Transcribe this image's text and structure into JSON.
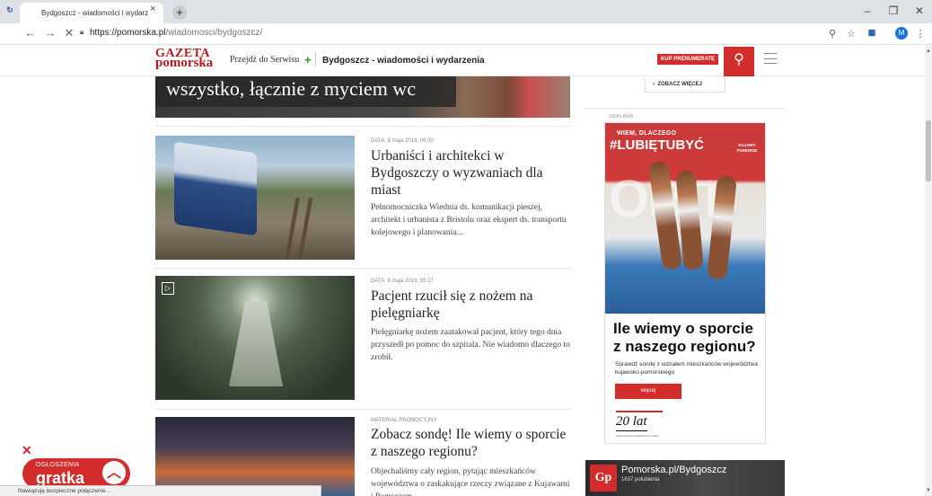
{
  "browser": {
    "tab_title": "Bydgoszcz - wiadomości i wydarz",
    "url_host": "https://pomorska.pl",
    "url_path": "/wiadomosci/bydgoszcz/",
    "profile_initial": "M"
  },
  "site": {
    "logo_line1": "GAZETA",
    "logo_line2": "pomorska",
    "przejdz": "Przejdź do Serwisu",
    "section_title": "Bydgoszcz - wiadomości i wydarzenia",
    "subscribe": "KUP PRENUMERATĘ",
    "accent_color": "#d22c2c"
  },
  "top_article": {
    "title_fragment": "wszystko, łącznie z myciem wc"
  },
  "sidebar": {
    "see_more": "ZOBACZ WIĘCEJ",
    "ad_label": "REKLAMA",
    "ad": {
      "kicker": "WIEM, DLACZEGO",
      "hashtag": "#LUBIĘTUBYĆ",
      "brand": "KUJAWY POMORZE",
      "headline": "Ile wiemy o sporcie z naszego regionu?",
      "subline": "Sprawdź sondę z udziałem mieszkańców województwa kujawsko-pomorskiego",
      "button": "więcej",
      "anniversary": "20 lat",
      "anniversary_sub": "Województwo Kujawsko-Pomorskie"
    },
    "facebook": {
      "name": "Pomorska.pl/Bydgoszcz",
      "likes": "1637 polubienia",
      "logo": "Gp"
    }
  },
  "articles": [
    {
      "meta": "DATA: 8 maja 2019, 06:30",
      "title": "Urbaniści i architekci w Bydgoszczy o wyzwaniach dla miast",
      "excerpt": "Pełnomocniczka Wiednia ds. komunikacji pieszej, architekt i urbanista z Bristolu oraz ekspert ds. transportu kolejowego i planowania..."
    },
    {
      "meta": "DATA: 8 maja 2019, 05:27",
      "title": "Pacjent rzucił się z nożem na pielęgniarkę",
      "excerpt": "Pielęgniarkę nożem zaatakował pacjent, który tego dnia przyszedł po pomoc do szpitala. Nie wiadomo dlaczego to zrobił."
    },
    {
      "meta": "MATERIAŁ PROMOCYJNY",
      "title": "Zobacz sondę! Ile wiemy o sporcie z naszego regionu?",
      "excerpt": "Objechaliśmy cały region, pytając mieszkańców województwa o zaskakujące rzeczy związane z Kujawami i Pomorzem"
    }
  ],
  "overlay": {
    "ogloszenia": "OGŁOSZENIA",
    "ogloszenia_brand": "gratka",
    "status": "Nawiązuję bezpieczne połączenie..."
  }
}
